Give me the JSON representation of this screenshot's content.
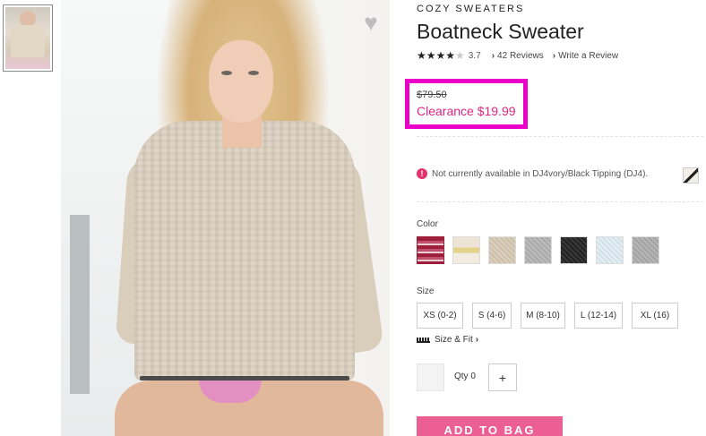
{
  "product": {
    "collection": "COZY SWEATERS",
    "name": "Boatneck Sweater",
    "rating": 3.7,
    "rating_text": "3.7",
    "stars_filled": "★★★★",
    "stars_empty": "★",
    "reviews_label": "42 Reviews",
    "write_review_label": "Write a Review"
  },
  "price": {
    "original": "$79.50",
    "clearance": "Clearance $19.99",
    "highlight_color": "#ea00c8",
    "clearance_color": "#e0267f"
  },
  "availability": {
    "notice": "Not currently available in DJ4vory/Black Tipping (DJ4).",
    "icon": "alert-circle-icon"
  },
  "color": {
    "label": "Color",
    "swatch_count": 7
  },
  "size": {
    "label": "Size",
    "options": [
      "XS (0-2)",
      "S (4-6)",
      "M (8-10)",
      "L (12-14)",
      "XL (16)"
    ],
    "fit_label": "Size & Fit"
  },
  "quantity": {
    "label": "Qty 0",
    "plus": "+"
  },
  "cta": {
    "add_to_bag": "ADD TO BAG",
    "color": "#ec5f95"
  },
  "icons": {
    "heart": "♥",
    "chevron": "›"
  }
}
